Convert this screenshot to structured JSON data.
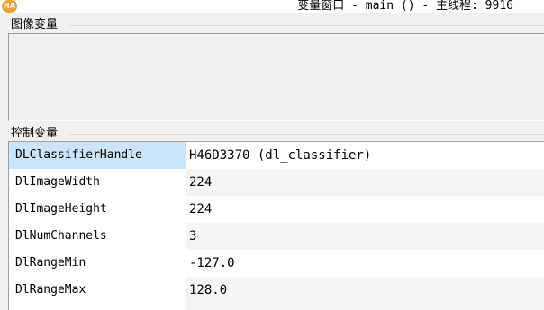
{
  "titlebar": {
    "icon_text": "HA",
    "title": "变量窗口 - main () - 主线程: 9916"
  },
  "image_vars_group": {
    "label": "图像变量"
  },
  "control_vars_group": {
    "label": "控制变量",
    "rows": [
      {
        "name": "DLClassifierHandle",
        "value": "H46D3370 (dl_classifier)"
      },
      {
        "name": "DlImageWidth",
        "value": "224"
      },
      {
        "name": "DlImageHeight",
        "value": "224"
      },
      {
        "name": "DlNumChannels",
        "value": "3"
      },
      {
        "name": "DlRangeMin",
        "value": "-127.0"
      },
      {
        "name": "DlRangeMax",
        "value": "128.0"
      }
    ]
  },
  "colors": {
    "selected_row": "#cce4f7",
    "alt_row": "#f5f5f5",
    "app_icon": "#f0a030"
  }
}
